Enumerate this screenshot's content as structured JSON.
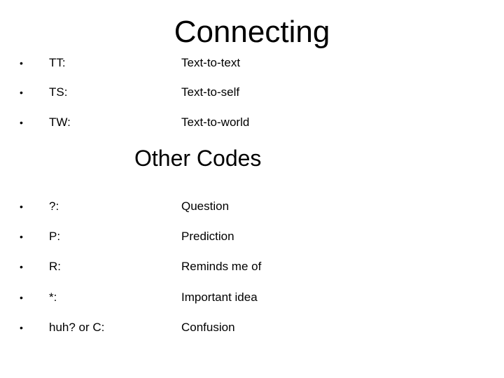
{
  "section1": {
    "title": "Connecting",
    "items": [
      {
        "bullet": "•",
        "code": "TT:",
        "meaning": "Text-to-text"
      },
      {
        "bullet": "•",
        "code": "TS:",
        "meaning": "Text-to-self"
      },
      {
        "bullet": "•",
        "code": "TW:",
        "meaning": "Text-to-world"
      }
    ]
  },
  "section2": {
    "title": "Other Codes",
    "items": [
      {
        "bullet": "•",
        "code": "?:",
        "meaning": "Question"
      },
      {
        "bullet": "•",
        "code": "P:",
        "meaning": "Prediction"
      },
      {
        "bullet": "•",
        "code": "R:",
        "meaning": "Reminds me of"
      },
      {
        "bullet": "•",
        "code": "*:",
        "meaning": "Important idea"
      },
      {
        "bullet": "•",
        "code": "huh? or C:",
        "meaning": "Confusion"
      }
    ]
  }
}
